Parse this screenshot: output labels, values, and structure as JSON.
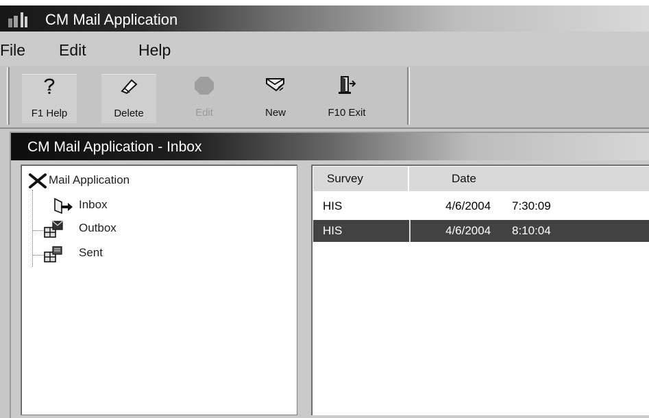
{
  "window": {
    "title": "CM Mail Application"
  },
  "menu": {
    "items": [
      "File",
      "Edit",
      "Help"
    ]
  },
  "toolbar": {
    "buttons": [
      {
        "label": "F1 Help",
        "icon": "help-icon",
        "enabled": true
      },
      {
        "label": "Delete",
        "icon": "eraser-icon",
        "enabled": true
      },
      {
        "label": "Edit",
        "icon": "edit-icon",
        "enabled": false
      },
      {
        "label": "New",
        "icon": "new-mail-icon",
        "enabled": true
      },
      {
        "label": "F10 Exit",
        "icon": "exit-door-icon",
        "enabled": true
      }
    ]
  },
  "inner_window": {
    "title": "CM Mail Application - Inbox"
  },
  "tree": {
    "root": {
      "label": "Mail Application",
      "icon": "x-mail-icon"
    },
    "children": [
      {
        "label": "Inbox",
        "icon": "inbox-icon"
      },
      {
        "label": "Outbox",
        "icon": "outbox-icon"
      },
      {
        "label": "Sent",
        "icon": "sent-icon"
      }
    ]
  },
  "list": {
    "columns": [
      "Survey",
      "Date"
    ],
    "rows": [
      {
        "survey": "HIS",
        "date": "4/6/2004",
        "time": "7:30:09",
        "selected": false
      },
      {
        "survey": "HIS",
        "date": "4/6/2004",
        "time": "8:10:04",
        "selected": true
      }
    ]
  },
  "colors": {
    "selection": "#424242",
    "chrome": "#c7c7c7"
  }
}
